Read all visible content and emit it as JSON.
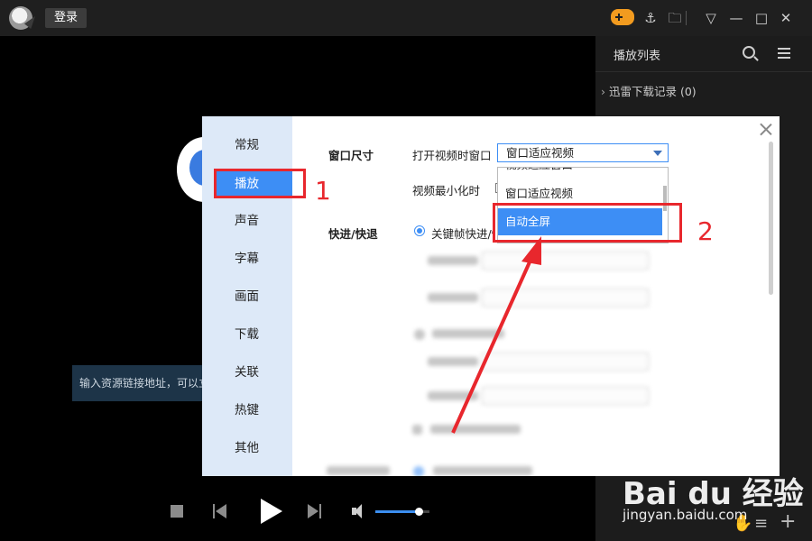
{
  "titlebar": {
    "login_label": "登录",
    "icons": [
      "game-controller-icon",
      "pin-icon",
      "folder-icon",
      "dropdown-menu-icon",
      "minimize-icon",
      "maximize-icon",
      "close-icon"
    ]
  },
  "playlist": {
    "title": "播放列表",
    "item": "迅雷下载记录 (0)"
  },
  "video_area": {
    "url_tip": "输入资源链接地址，可以立"
  },
  "player": {
    "volume_level": 0.8
  },
  "dialog": {
    "nav": [
      "常规",
      "播放",
      "声音",
      "字幕",
      "画面",
      "下载",
      "关联",
      "热键",
      "其他"
    ],
    "active_nav": "播放",
    "window_size_label": "窗口尺寸",
    "open_video_window_label": "打开视频时窗口",
    "open_video_window_value": "窗口适应视频",
    "minimize_label": "视频最小化时",
    "dropdown_options": [
      "视频适应窗口",
      "窗口适应视频",
      "自动全屏"
    ],
    "dropdown_selected": "自动全屏",
    "seek_label": "快进/快退",
    "seek_option": "关键帧快进/快退"
  },
  "annotations": {
    "num1": "1",
    "num2": "2"
  },
  "watermark": {
    "logo": "Bai du 经验",
    "url": "jingyan.baidu.com"
  },
  "colors": {
    "accent": "#3d8ef5",
    "annotation": "#e8272d",
    "titlebar_bg": "#1f1f1f",
    "playlist_bg": "#1c1c1c",
    "nav_bg": "#dde9f8"
  }
}
